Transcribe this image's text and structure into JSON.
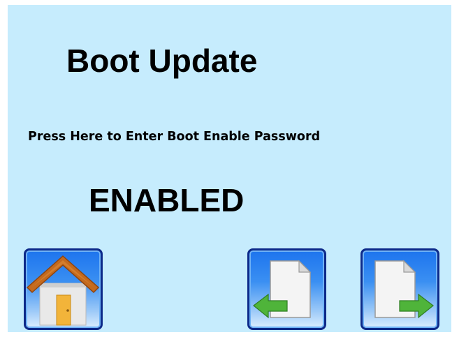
{
  "screen": {
    "title": "Boot Update",
    "prompt_label": "Press Here to Enter Boot Enable Password",
    "status_value": "ENABLED",
    "background_color": "#c6ecfd"
  },
  "nav": {
    "home_icon": "house-icon",
    "back_icon": "page-back-arrow-icon",
    "next_icon": "page-forward-arrow-icon",
    "button_border_color": "#0d2a8a",
    "button_fill_color": "#1d74ee",
    "arrow_color": "#4fb43a"
  }
}
